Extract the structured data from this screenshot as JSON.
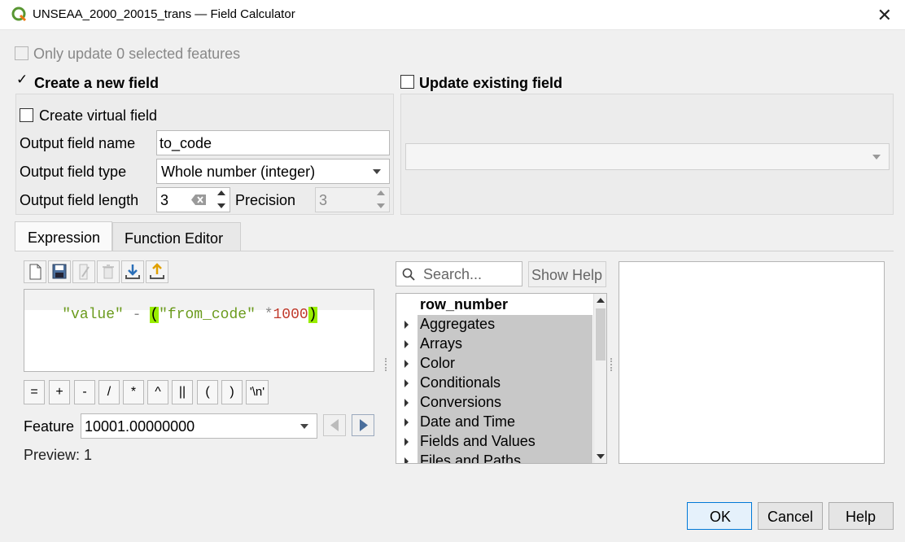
{
  "window": {
    "title": "UNSEAA_2000_20015_trans — Field Calculator",
    "close_glyph": "✕"
  },
  "only_update": {
    "label": "Only update 0 selected features"
  },
  "create_new": {
    "label": "Create a new field",
    "check_glyph": "✓"
  },
  "update_existing": {
    "label": "Update existing field"
  },
  "virtual_field": {
    "label": "Create virtual field"
  },
  "output_name": {
    "label": "Output field name",
    "value": "to_code"
  },
  "output_type": {
    "label": "Output field type",
    "value": "Whole number (integer)"
  },
  "output_length": {
    "label": "Output field length",
    "value": "3"
  },
  "precision": {
    "label": "Precision",
    "value": "3"
  },
  "tabs": [
    {
      "label": "Expression"
    },
    {
      "label": "Function Editor"
    }
  ],
  "expression": {
    "parts": [
      "\"value\"",
      " - ",
      "(",
      "\"from_code\"",
      " *",
      "1000",
      ")"
    ]
  },
  "operators": [
    "=",
    "+",
    "-",
    "/",
    "*",
    "^",
    "||",
    "(",
    ")",
    "'\\n'"
  ],
  "feature": {
    "label": "Feature",
    "value": "10001.00000000"
  },
  "preview": {
    "text": "Preview: 1"
  },
  "search": {
    "placeholder": "Search..."
  },
  "show_help": {
    "label": "Show Help"
  },
  "function_tree": {
    "items": [
      "row_number",
      "Aggregates",
      "Arrays",
      "Color",
      "Conditionals",
      "Conversions",
      "Date and Time",
      "Fields and Values",
      "Files and Paths"
    ]
  },
  "buttons": {
    "ok": "OK",
    "cancel": "Cancel",
    "help": "Help"
  },
  "colors": {
    "accent": "#0078d7",
    "string": "#6b9b1d",
    "number": "#c0392b",
    "bracket_highlight": "#99ee00",
    "tree_highlight": "#c8c8c8"
  }
}
